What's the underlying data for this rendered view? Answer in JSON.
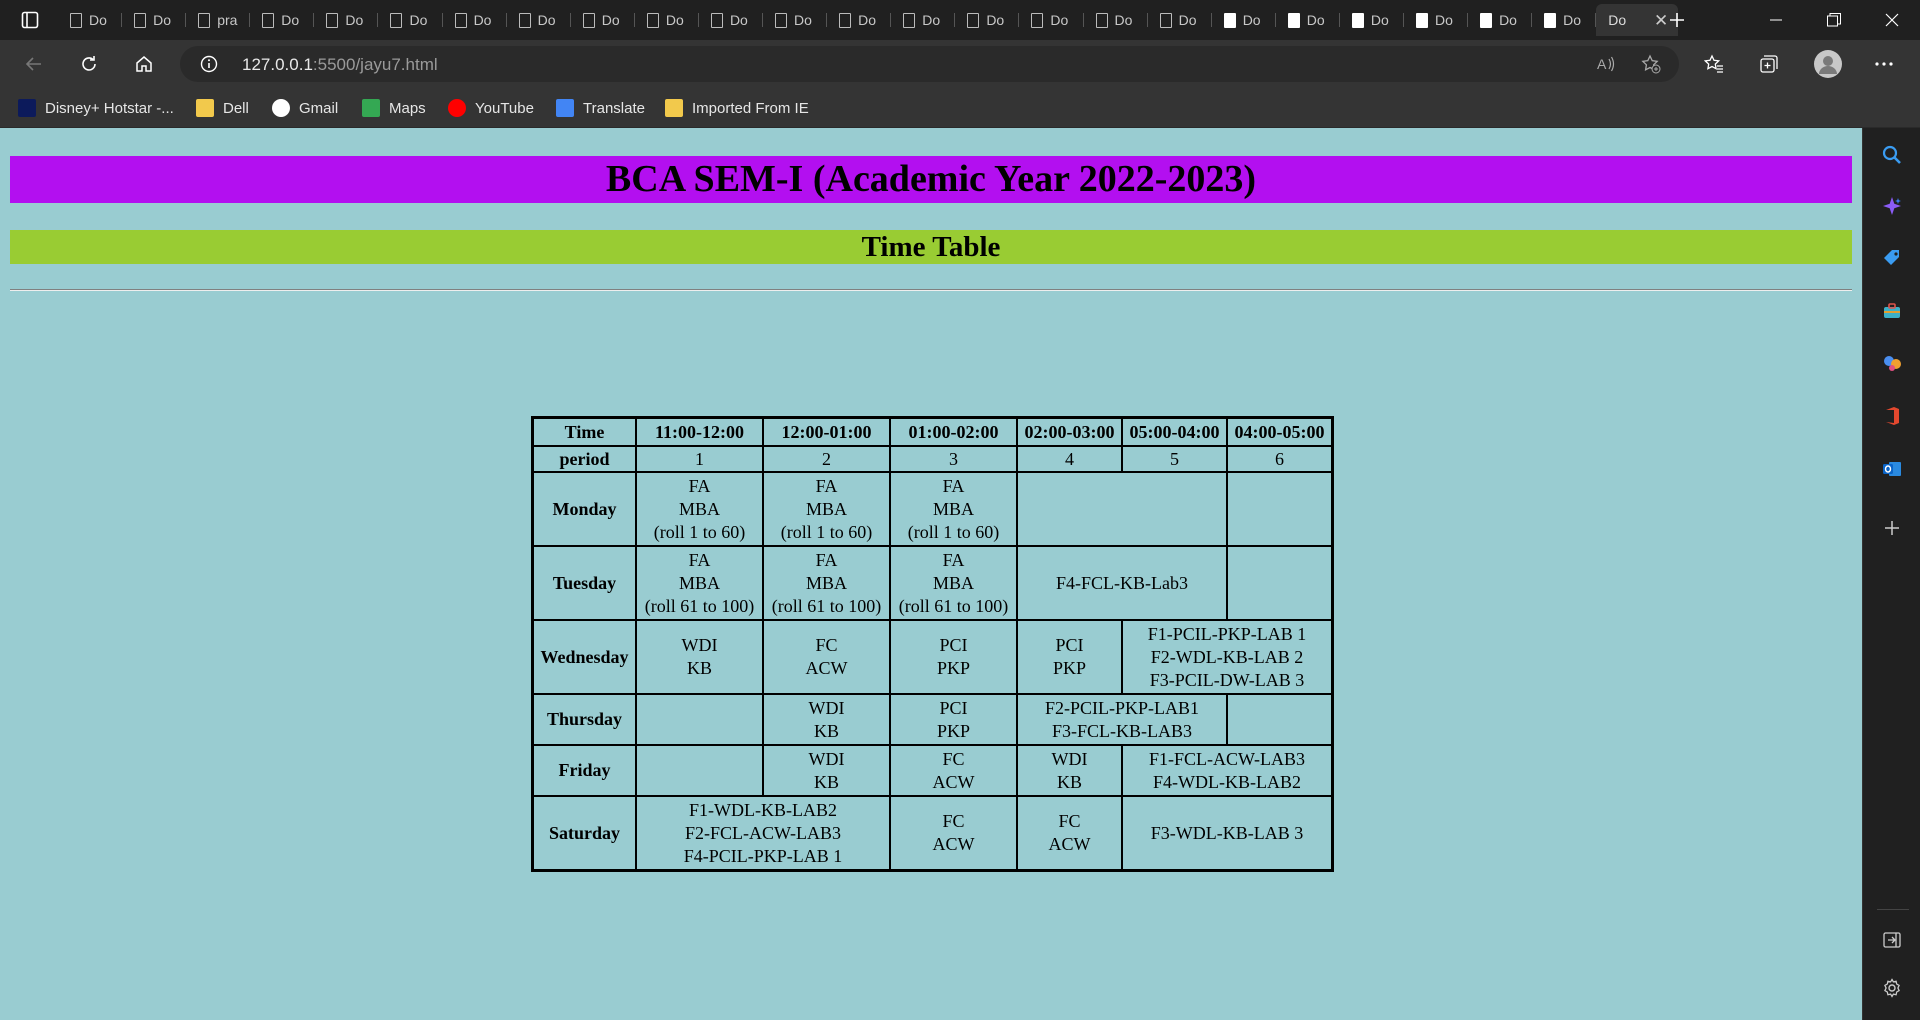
{
  "browser": {
    "tab_labels": [
      "Do",
      "Do",
      "pra",
      "Do",
      "Do",
      "Do",
      "Do",
      "Do",
      "Do",
      "Do",
      "Do",
      "Do",
      "Do",
      "Do",
      "Do",
      "Do",
      "Do",
      "Do",
      "Do",
      "Do",
      "Do",
      "Do",
      "Do",
      "Do"
    ],
    "active_tab_label": "Do",
    "url_host": "127.0.0.1",
    "url_path": ":5500/jayu7.html"
  },
  "bookmarks": [
    {
      "label": "Disney+ Hotstar -...",
      "icon": "hotstar-icon",
      "color": "#0c1a5b"
    },
    {
      "label": "Dell",
      "icon": "folder-icon",
      "color": "#f2c94c"
    },
    {
      "label": "Gmail",
      "icon": "google-icon",
      "color": "#ffffff"
    },
    {
      "label": "Maps",
      "icon": "maps-icon",
      "color": "#34a853"
    },
    {
      "label": "YouTube",
      "icon": "youtube-icon",
      "color": "#ff0000"
    },
    {
      "label": "Translate",
      "icon": "translate-icon",
      "color": "#4285f4"
    },
    {
      "label": "Imported From IE",
      "icon": "folder-icon",
      "color": "#f2c94c"
    }
  ],
  "page": {
    "heading": "BCA SEM-I (Academic Year 2022-2023)",
    "subheading": "Time Table",
    "heading_bg": "#b30ff0",
    "subheading_bg": "#99cc33",
    "page_bg": "#99ccd1"
  },
  "timetable": {
    "header": {
      "time_label": "Time",
      "slots": [
        "11:00-12:00",
        "12:00-01:00",
        "01:00-02:00",
        "02:00-03:00",
        "05:00-04:00",
        "04:00-05:00"
      ]
    },
    "period": {
      "label": "period",
      "numbers": [
        "1",
        "2",
        "3",
        "4",
        "5",
        "6"
      ]
    },
    "days": [
      "Monday",
      "Tuesday",
      "Wednesday",
      "Thursday",
      "Friday",
      "Saturday"
    ],
    "cells": {
      "mon_1": [
        "FA",
        "MBA",
        "(roll 1 to 60)"
      ],
      "mon_2": [
        "FA",
        "MBA",
        "(roll 1 to 60)"
      ],
      "mon_3": [
        "FA",
        "MBA",
        "(roll 1 to 60)"
      ],
      "tue_1": [
        "FA",
        "MBA",
        "(roll 61 to 100)"
      ],
      "tue_2": [
        "FA",
        "MBA",
        "(roll 61 to 100)"
      ],
      "tue_3": [
        "FA",
        "MBA",
        "(roll 61 to 100)"
      ],
      "tue_45": [
        "F4-FCL-KB-Lab3"
      ],
      "wed_1": [
        "WDI",
        "KB"
      ],
      "wed_2": [
        "FC",
        "ACW"
      ],
      "wed_3": [
        "PCI",
        "PKP"
      ],
      "wed_4": [
        "PCI",
        "PKP"
      ],
      "wed_56": [
        "F1-PCIL-PKP-LAB 1",
        "F2-WDL-KB-LAB 2",
        "F3-PCIL-DW-LAB 3"
      ],
      "thu_2": [
        "WDI",
        "KB"
      ],
      "thu_3": [
        "PCI",
        "PKP"
      ],
      "thu_45": [
        "F2-PCIL-PKP-LAB1",
        "F3-FCL-KB-LAB3"
      ],
      "fri_2": [
        "WDI",
        "KB"
      ],
      "fri_3": [
        "FC",
        "ACW"
      ],
      "fri_4": [
        "WDI",
        "KB"
      ],
      "fri_56": [
        "F1-FCL-ACW-LAB3",
        "F4-WDL-KB-LAB2"
      ],
      "sat_12": [
        "F1-WDL-KB-LAB2",
        "F2-FCL-ACW-LAB3",
        "F4-PCIL-PKP-LAB 1"
      ],
      "sat_3": [
        "FC",
        "ACW"
      ],
      "sat_4": [
        "FC",
        "ACW"
      ],
      "sat_56": [
        "F3-WDL-KB-LAB 3"
      ]
    }
  }
}
